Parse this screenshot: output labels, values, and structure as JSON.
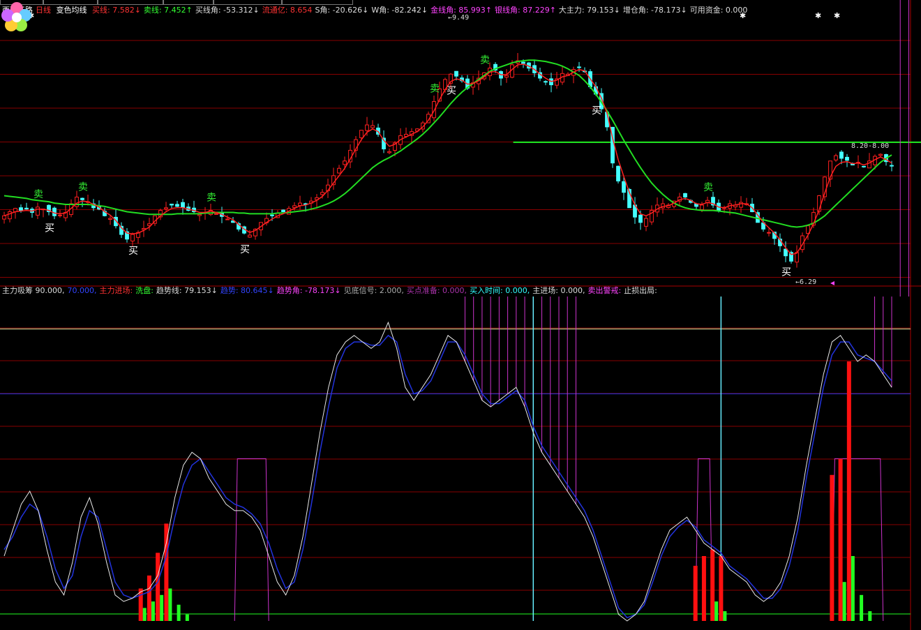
{
  "upper_legend": {
    "stock": "西藏天路",
    "period": "日线",
    "indicator": "变色均线",
    "items": [
      {
        "label": "买线: 7.582↓",
        "color": "#ff3333"
      },
      {
        "label": "卖线: 7.452↑",
        "color": "#33ff33"
      },
      {
        "label": "买线角: -53.312↓",
        "color": "#dddddd"
      },
      {
        "label": "流通亿: 8.654",
        "color": "#ff3333"
      },
      {
        "label": "S角: -20.626↓",
        "color": "#dddddd"
      },
      {
        "label": "W角: -82.242↓",
        "color": "#dddddd"
      },
      {
        "label": "金线角: 85.993↑",
        "color": "#ff44ff"
      },
      {
        "label": "银线角: 87.229↑",
        "color": "#ff44ff"
      },
      {
        "label": "大主力: 79.153↓",
        "color": "#dddddd"
      },
      {
        "label": "增仓角: -78.173↓",
        "color": "#dddddd"
      },
      {
        "label": "可用资金: 0.000",
        "color": "#dddddd"
      }
    ]
  },
  "lower_legend": {
    "items": [
      {
        "label": "主力吸筹 90.000,",
        "color": "#dddddd"
      },
      {
        "label": "70.000,",
        "color": "#3344ff"
      },
      {
        "label": "主力进场:",
        "color": "#ff3333"
      },
      {
        "label": "洗盘:",
        "color": "#33ff33"
      },
      {
        "label": "趋势线: 79.153↓",
        "color": "#dddddd"
      },
      {
        "label": "趋势: 80.645↓",
        "color": "#3344ff"
      },
      {
        "label": "趋势角: -78.173↓",
        "color": "#ff44ff"
      },
      {
        "label": "见底信号: 2.000,",
        "color": "#aaaaaa"
      },
      {
        "label": "买点准备: 0.000,",
        "color": "#aa33aa"
      },
      {
        "label": "买入时间: 0.000,",
        "color": "#33ffff"
      },
      {
        "label": "主进场: 0.000,",
        "color": "#dddddd"
      },
      {
        "label": "卖出警戒:",
        "color": "#ff44ff"
      },
      {
        "label": "止损出局:",
        "color": "#dddddd"
      }
    ]
  },
  "colors": {
    "up": "#ff2020",
    "down": "#44ffff",
    "ma_buy": "#ff2020",
    "ma_trend": "#22dd22",
    "grid": "#880000",
    "white_line": "#e8e8e8",
    "blue_line": "#2233dd",
    "purple": "#cc33cc",
    "yellow": "#e8e8a0",
    "red_bar": "#ff1010",
    "green_bar": "#22ff22",
    "cyan_spike": "#66eeff"
  },
  "chart_data": [
    {
      "type": "candlestick",
      "title": "变色均线",
      "ylim": [
        6.0,
        10.0
      ],
      "price_labels": {
        "high": "9.49",
        "low": "6.29",
        "right_level": "8.20-8.00"
      },
      "level_line": 8.1,
      "closes": [
        7.0,
        7.06,
        7.11,
        7.08,
        7.1,
        7.05,
        7.13,
        7.1,
        7.06,
        7.0,
        7.01,
        7.05,
        7.18,
        7.28,
        7.24,
        7.21,
        7.12,
        7.1,
        7.0,
        6.96,
        6.85,
        6.72,
        6.65,
        6.72,
        6.75,
        6.81,
        6.88,
        7.0,
        7.08,
        7.12,
        7.16,
        7.14,
        7.12,
        7.08,
        7.06,
        7.02,
        7.05,
        7.08,
        7.03,
        6.99,
        6.95,
        6.9,
        6.8,
        6.74,
        6.71,
        6.8,
        6.9,
        6.96,
        7.0,
        7.04,
        7.06,
        7.11,
        7.15,
        7.19,
        7.17,
        7.22,
        7.27,
        7.35,
        7.46,
        7.6,
        7.71,
        7.82,
        7.98,
        8.14,
        8.28,
        8.36,
        8.35,
        8.22,
        8.0,
        7.96,
        8.09,
        8.2,
        8.22,
        8.26,
        8.3,
        8.39,
        8.52,
        8.71,
        8.9,
        9.04,
        9.12,
        9.09,
        9.02,
        8.91,
        8.99,
        9.06,
        9.14,
        9.21,
        9.18,
        9.06,
        9.1,
        9.26,
        9.32,
        9.28,
        9.21,
        9.14,
        9.06,
        9.0,
        8.96,
        9.05,
        9.13,
        9.12,
        9.19,
        9.22,
        9.16,
        8.93,
        8.82,
        8.6,
        8.33,
        7.79,
        7.52,
        7.35,
        7.12,
        6.98,
        6.9,
        6.96,
        7.08,
        7.16,
        7.18,
        7.16,
        7.22,
        7.28,
        7.28,
        7.2,
        7.14,
        7.16,
        7.23,
        7.16,
        7.08,
        7.12,
        7.18,
        7.16,
        7.2,
        7.18,
        7.06,
        6.9,
        6.8,
        6.75,
        6.66,
        6.55,
        6.4,
        6.32,
        6.45,
        6.7,
        6.85,
        7.05,
        7.3,
        7.58,
        7.82,
        7.9,
        7.86,
        7.83,
        7.76,
        7.8,
        7.74,
        7.82,
        7.89,
        7.92,
        7.81,
        7.75
      ],
      "series": [
        {
          "name": "买线",
          "values": [
            7.0,
            7.03,
            7.06,
            7.07,
            7.08,
            7.07,
            7.1,
            7.1,
            7.08,
            7.04,
            7.03,
            7.04,
            7.11,
            7.19,
            7.22,
            7.21,
            7.17,
            7.13,
            7.06,
            7.01,
            6.93,
            6.82,
            6.74,
            6.73,
            6.74,
            6.78,
            6.83,
            6.92,
            7.0,
            7.06,
            7.11,
            7.12,
            7.12,
            7.1,
            7.08,
            7.05,
            7.05,
            7.07,
            7.05,
            7.02,
            6.98,
            6.94,
            6.87,
            6.8,
            6.75,
            6.78,
            6.84,
            6.9,
            6.95,
            7.0,
            7.03,
            7.07,
            7.11,
            7.15,
            7.16,
            7.19,
            7.23,
            7.29,
            7.38,
            7.49,
            7.6,
            7.71,
            7.85,
            8.0,
            8.14,
            8.25,
            8.3,
            8.26,
            8.13,
            8.04,
            8.07,
            8.14,
            8.18,
            8.22,
            8.26,
            8.33,
            8.43,
            8.57,
            8.74,
            8.89,
            9.01,
            9.05,
            9.03,
            8.97,
            8.98,
            9.02,
            9.08,
            9.15,
            9.16,
            9.11,
            9.11,
            9.19,
            9.26,
            9.27,
            9.24,
            9.19,
            9.12,
            9.06,
            9.01,
            9.03,
            9.08,
            9.1,
            9.15,
            9.19,
            9.17,
            9.05,
            8.93,
            8.76,
            8.54,
            8.16,
            7.84,
            7.59,
            7.35,
            7.16,
            7.03,
            7.0,
            7.04,
            7.1,
            7.14,
            7.15,
            7.19,
            7.24,
            7.26,
            7.23,
            7.18,
            7.17,
            7.2,
            7.18,
            7.13,
            7.12,
            7.15,
            7.16,
            7.18,
            7.18,
            7.12,
            7.01,
            6.9,
            6.82,
            6.74,
            6.64,
            6.52,
            6.42,
            6.44,
            6.57,
            6.71,
            6.88,
            7.09,
            7.34,
            7.58,
            7.74,
            7.8,
            7.81,
            7.78,
            7.79,
            7.76,
            7.79,
            7.84,
            7.88,
            7.84,
            7.79
          ]
        },
        {
          "name": "卖线",
          "values": [
            7.3,
            7.29,
            7.28,
            7.27,
            7.26,
            7.24,
            7.23,
            7.22,
            7.21,
            7.19,
            7.18,
            7.17,
            7.17,
            7.17,
            7.17,
            7.17,
            7.16,
            7.15,
            7.14,
            7.12,
            7.1,
            7.08,
            7.06,
            7.05,
            7.04,
            7.03,
            7.02,
            7.02,
            7.02,
            7.02,
            7.02,
            7.03,
            7.03,
            7.03,
            7.03,
            7.03,
            7.04,
            7.04,
            7.05,
            7.05,
            7.05,
            7.05,
            7.04,
            7.04,
            7.03,
            7.03,
            7.03,
            7.03,
            7.03,
            7.04,
            7.04,
            7.05,
            7.06,
            7.07,
            7.08,
            7.1,
            7.12,
            7.15,
            7.18,
            7.22,
            7.27,
            7.33,
            7.4,
            7.48,
            7.56,
            7.64,
            7.72,
            7.78,
            7.83,
            7.87,
            7.92,
            7.97,
            8.03,
            8.09,
            8.15,
            8.22,
            8.3,
            8.39,
            8.48,
            8.58,
            8.68,
            8.77,
            8.85,
            8.92,
            8.98,
            9.04,
            9.1,
            9.16,
            9.2,
            9.23,
            9.26,
            9.29,
            9.31,
            9.32,
            9.33,
            9.33,
            9.32,
            9.31,
            9.29,
            9.27,
            9.24,
            9.2,
            9.15,
            9.1,
            9.02,
            8.93,
            8.82,
            8.7,
            8.57,
            8.43,
            8.28,
            8.13,
            7.99,
            7.85,
            7.72,
            7.6,
            7.49,
            7.4,
            7.32,
            7.25,
            7.19,
            7.15,
            7.12,
            7.1,
            7.09,
            7.08,
            7.08,
            7.08,
            7.07,
            7.06,
            7.05,
            7.04,
            7.02,
            7.0,
            6.98,
            6.96,
            6.94,
            6.92,
            6.9,
            6.88,
            6.86,
            6.84,
            6.83,
            6.84,
            6.86,
            6.89,
            6.94,
            7.0,
            7.08,
            7.16,
            7.24,
            7.32,
            7.4,
            7.48,
            7.56,
            7.64,
            7.72,
            7.8,
            7.86,
            7.91
          ]
        }
      ],
      "signals": [
        {
          "index": 6,
          "text": "卖",
          "kind": "sell"
        },
        {
          "index": 8,
          "text": "买",
          "kind": "buy"
        },
        {
          "index": 14,
          "text": "卖",
          "kind": "sell"
        },
        {
          "index": 23,
          "text": "买",
          "kind": "buy"
        },
        {
          "index": 37,
          "text": "卖",
          "kind": "sell"
        },
        {
          "index": 43,
          "text": "买",
          "kind": "buy"
        },
        {
          "index": 77,
          "text": "卖",
          "kind": "sell"
        },
        {
          "index": 80,
          "text": "买",
          "kind": "buy"
        },
        {
          "index": 86,
          "text": "卖",
          "kind": "sell"
        },
        {
          "index": 106,
          "text": "买",
          "kind": "buy"
        },
        {
          "index": 126,
          "text": "卖",
          "kind": "sell"
        },
        {
          "index": 140,
          "text": "买",
          "kind": "buy"
        }
      ]
    },
    {
      "type": "line",
      "title": "主力吸筹",
      "ylim": [
        0,
        100
      ],
      "levels": [
        90,
        70
      ],
      "series": [
        {
          "name": "趋势线",
          "values": [
            20,
            28,
            36,
            40,
            34,
            22,
            12,
            8,
            18,
            32,
            38,
            30,
            18,
            8,
            6,
            7,
            9,
            10,
            14,
            24,
            38,
            48,
            52,
            50,
            44,
            40,
            36,
            34,
            34,
            32,
            28,
            20,
            12,
            8,
            14,
            26,
            42,
            58,
            72,
            82,
            86,
            88,
            86,
            84,
            86,
            92,
            84,
            72,
            68,
            72,
            76,
            82,
            88,
            86,
            80,
            74,
            68,
            66,
            68,
            70,
            72,
            66,
            58,
            52,
            48,
            44,
            40,
            36,
            32,
            26,
            18,
            10,
            2,
            0,
            2,
            6,
            14,
            22,
            28,
            30,
            32,
            28,
            24,
            22,
            20,
            16,
            14,
            12,
            8,
            6,
            8,
            12,
            20,
            32,
            48,
            62,
            76,
            86,
            88,
            84,
            80,
            82,
            80,
            76,
            72
          ]
        },
        {
          "name": "趋势",
          "values": [
            22,
            26,
            32,
            36,
            34,
            26,
            16,
            10,
            14,
            26,
            34,
            32,
            22,
            12,
            8,
            7,
            8,
            9,
            12,
            20,
            32,
            42,
            48,
            50,
            46,
            42,
            38,
            36,
            35,
            33,
            30,
            24,
            16,
            10,
            12,
            22,
            36,
            52,
            66,
            78,
            84,
            86,
            86,
            85,
            85,
            88,
            86,
            76,
            70,
            71,
            74,
            80,
            86,
            86,
            82,
            76,
            70,
            67,
            67,
            69,
            71,
            68,
            60,
            54,
            50,
            46,
            42,
            38,
            34,
            28,
            20,
            12,
            4,
            1,
            2,
            5,
            12,
            20,
            26,
            29,
            31,
            29,
            25,
            23,
            21,
            17,
            15,
            13,
            10,
            7,
            7,
            10,
            17,
            28,
            44,
            58,
            72,
            82,
            86,
            86,
            82,
            81,
            80,
            77,
            74
          ]
        }
      ],
      "bars_red": [],
      "bars_green": [],
      "purple_signal_ranges": [
        [
          27,
          31
        ],
        [
          81,
          83
        ],
        [
          97,
          103
        ]
      ],
      "cyan_spikes": [
        62,
        84
      ],
      "sell_warning_indices": [
        54,
        55,
        56,
        57,
        58,
        59,
        60,
        61,
        62,
        63,
        64,
        65,
        66,
        67,
        102,
        103,
        104,
        105,
        106
      ]
    }
  ]
}
